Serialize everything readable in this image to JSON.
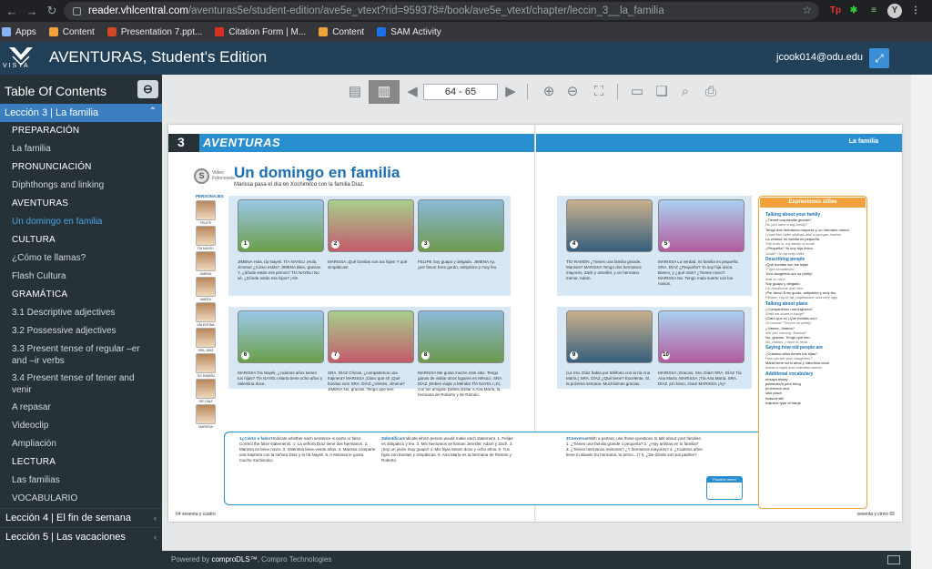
{
  "browser": {
    "url_host": "reader.vhlcentral.com",
    "url_path": "/aventuras5e/student-edition/ave5e_vtext?rid=959378#/book/ave5e_vtext/chapter/leccin_3__la_familia",
    "bookmarks": [
      {
        "label": "Apps",
        "icon": "apps-icon",
        "color": "#8ab4f8"
      },
      {
        "label": "Content",
        "icon": "content-icon",
        "color": "#f2a23a"
      },
      {
        "label": "Presentation 7.ppt...",
        "icon": "presentation-icon",
        "color": "#d24726"
      },
      {
        "label": "Citation Form | M...",
        "icon": "citation-icon",
        "color": "#d93025"
      },
      {
        "label": "Content",
        "icon": "content-icon",
        "color": "#f2a23a"
      },
      {
        "label": "SAM Activity",
        "icon": "sam-icon",
        "color": "#1a73e8"
      }
    ]
  },
  "header": {
    "logo_text": "VISTA",
    "title": "AVENTURAS, Student's Edition",
    "user_email": "jcook014@odu.edu"
  },
  "sidebar": {
    "title": "Table Of Contents",
    "current_lesson": "Lección 3 | La familia",
    "items": [
      {
        "kind": "sec",
        "label": "PREPARACIÓN"
      },
      {
        "kind": "itm",
        "label": "La familia"
      },
      {
        "kind": "sec",
        "label": "PRONUNCIACIÓN"
      },
      {
        "kind": "itm",
        "label": "Diphthongs and linking"
      },
      {
        "kind": "sec",
        "label": "AVENTURAS"
      },
      {
        "kind": "itm",
        "label": "Un domingo en familia",
        "active": true
      },
      {
        "kind": "sec",
        "label": "CULTURA"
      },
      {
        "kind": "itm",
        "label": "¿Cómo te llamas?"
      },
      {
        "kind": "itm",
        "label": "Flash Cultura"
      },
      {
        "kind": "sec",
        "label": "GRAMÁTICA"
      },
      {
        "kind": "itm",
        "label": "3.1 Descriptive adjectives"
      },
      {
        "kind": "itm",
        "label": "3.2 Possessive adjectives"
      },
      {
        "kind": "itm",
        "label": "3.3 Present tense of regular –er and –ir verbs",
        "tall": true
      },
      {
        "kind": "itm",
        "label": "3.4 Present tense of tener and venir",
        "tall": true
      },
      {
        "kind": "itm",
        "label": "A repasar"
      },
      {
        "kind": "itm",
        "label": "Videoclip"
      },
      {
        "kind": "itm",
        "label": "Ampliación"
      },
      {
        "kind": "sec",
        "label": "LECTURA"
      },
      {
        "kind": "itm",
        "label": "Las familias"
      },
      {
        "kind": "itm",
        "label": "VOCABULARIO"
      }
    ],
    "lessons": [
      "Lección 4 | El fin de semana",
      "Lección 5 | Las vacaciones"
    ]
  },
  "toolbar": {
    "page_range": "64 - 65"
  },
  "book": {
    "chapter_num": "3",
    "section": "AVENTURAS",
    "header_right": "La familia",
    "video_label": "Video: Fotonovela",
    "story_title": "Un domingo en familia",
    "story_sub": "Marissa pasa el día en Xochimilco con la familia Díaz.",
    "personajes_label": "PERSONAJES",
    "characters": [
      "FELIPE",
      "TÍA NAYELI",
      "JIMENA",
      "MARTA",
      "VALENTINA",
      "SRA. DÍAZ",
      "TÍO RAMÓN",
      "SR. DÍAZ",
      "MARISSA"
    ],
    "panels_top": [
      {
        "n": "1",
        "text": "JIMENA Hola, tía Nayeli. TÍA NAYELI ¡Hola, Jimena! ¿Cómo estás? JIMENA Bien, gracias. Y, ¿dónde están mis primos? TÍA NAYELI No sé. ¿Dónde están mis hijos? ¡Ah!"
      },
      {
        "n": "2",
        "text": "MARISSA ¡Qué bonitas son tus hijas! Y qué simpáticas!"
      },
      {
        "n": "3",
        "text": "FELIPE Soy guapo y delgado. JIMENA Ay, ¡por favor! Eres gordo, antipático y muy feo."
      },
      {
        "n": "4",
        "text": "TÍO RAMÓN ¿Tienes una familia grande, Marissa? MARISSA Tengo dos hermanos mayores, Zack y Jennifer, y un hermano menor, Adam."
      },
      {
        "n": "5",
        "text": "MARISSA La verdad, mi familia es pequeña. SRA. DÍAZ ¿Pequeña? Yo soy hija única. Bueno, y ¿qué más? ¿Tienes novio? MARISSA No. Tengo mala suerte con los novios."
      }
    ],
    "panels_bottom": [
      {
        "n": "6",
        "text": "MARISSA Tía Nayeli, ¿cuántos años tienen tus hijas? TÍA NAYELI Marta tiene ocho años y Valentina doce."
      },
      {
        "n": "7",
        "text": "SRA. DÍAZ Chicas, ¿compartimos una trajinera? MARISSA ¡Claro que sí! ¡Qué bonitas son! SRA. DÍAZ ¿Vienes, Jimena? JIMENA No, gracias. Tengo que leer."
      },
      {
        "n": "8",
        "text": "MARISSA Me gusta mucho este sitio. Tengo ganas de visitar otros lugares en México. SRA. DÍAZ ¡Debes viajar a Mérida! TÍA NAYELI ¡Sí, con tus amigas! Debes visitar a Ana María, la hermana de Roberto y de Ramón."
      },
      {
        "n": "9",
        "text": "(La Sra. Díaz habla por teléfono con la tía Ana María.) SRA. DÍAZ ¿Qué tiene? Excelente. Sí, la próxima semana. Muchísimas gracias."
      },
      {
        "n": "10",
        "text": "MARISSA ¡Gracias, Sra. Díaz! SRA. DÍAZ Tía Ana María. MARISSA ¡Tía Ana María. SRA. DÍAZ ¡Un beso, chau! MARISSA ¡Ay!"
      }
    ],
    "activities": [
      {
        "n": "1",
        "title": "¿Cierto o falso?",
        "text": "Indicate whether each sentence is cierto or falso. Correct the false statements. 1. La señora Díaz tiene dos hermanos. 2. Marissa no tiene novio. 3. Valentina tiene veinte años. 4. Marissa comparte una trajinera con la señora Díaz y la tía Nayeli. 5. A Marissa le gusta mucho Xochimilco."
      },
      {
        "n": "2",
        "title": "Identificar",
        "text": "Indicate which person would make each statement. 1. Felipe es antipático y feo. 2. Mis hermanos se llaman Jennifer, Adam y Zach. 3. ¡Soy un joven muy guapo! 4. Mis hijas tienen doce y ocho años. 5. Tus hijas son bonitas y simpáticas. 6. Ana María es la hermana de Ramón y Roberto."
      },
      {
        "n": "3",
        "title": "Conversar",
        "text": "With a partner, use these questions to talk about your families. 1. ¿Tienes una familia grande o pequeña? 2. ¿Hay artistas en tu familia? 3. ¿Tienes hermanos menores? ¿Y hermanos mayores? 4. ¿Cuántos años tiene tu abuelo (tu hermana, tu primo...)? 5. ¿De dónde son tus padres?"
      }
    ],
    "activities_tab": "ACTIVIDADES",
    "practice_label": "Practice more!",
    "expr_title": "Expresiones útiles",
    "expr": [
      {
        "h": "Talking about your family",
        "lines": [
          "¿Tienes una familia grande?",
          "Do you have a big family?",
          "Tengo dos hermanos mayores y un hermano menor.",
          "I have two older siblings and a younger brother.",
          "La verdad, mi familia es pequeña.",
          "The truth is, my family is small.",
          "¿Pequeña? Yo soy hija única.",
          "Small? I'm an only child."
        ]
      },
      {
        "h": "Describing people",
        "lines": [
          "¡Qué bonitas son tus hijas!",
          "Y qué simpáticas!",
          "Your daughters are so pretty!",
          "And so nice!",
          "Soy guapo y delgado.",
          "I'm handsome and slim.",
          "¡Por favor! Eres gordo, antipático y muy feo.",
          "Please! You're fat, unpleasant, and very ugly."
        ]
      },
      {
        "h": "Talking about plans",
        "lines": [
          "¿Compartimos una trajinera?",
          "Shall we share a barge?",
          "¡Claro que sí! ¡Qué bonitas son!",
          "Of course! They're so pretty!",
          "¿Vienes, Jimena?",
          "Are you coming, Jimena?",
          "No, gracias. Tengo que leer.",
          "No, thanks. I have to read."
        ]
      },
      {
        "h": "Saying how old people are",
        "lines": [
          "¿Cuántos años tienen tus hijas?",
          "How old are your daughters?",
          "Marta tiene ocho años y Valentina doce.",
          "Marta is eight and Valentina twelve."
        ]
      },
      {
        "h": "Additional vocabulary",
        "lines": [
          "ensayo essay",
          "pobrecito/a poor thing",
          "próximo/a next",
          "sitio place",
          "todavía still",
          "trajinera type of barge"
        ]
      }
    ],
    "page_left": "64  sesenta y cuatro",
    "page_right": "sesenta y cinco  65"
  },
  "footer": {
    "powered_by": "Powered by ",
    "brand": "comproDLS™",
    "rest": ", Compro Technologies"
  }
}
